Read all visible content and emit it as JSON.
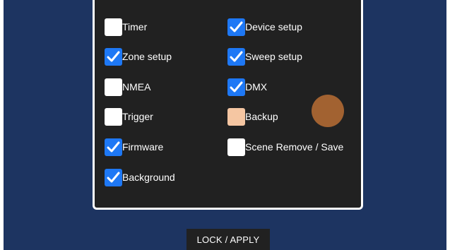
{
  "checkboxes": [
    {
      "label": "Timer",
      "checked": false
    },
    {
      "label": "Device setup",
      "checked": true
    },
    {
      "label": "Zone setup",
      "checked": true
    },
    {
      "label": "Sweep setup",
      "checked": true
    },
    {
      "label": "NMEA",
      "checked": false
    },
    {
      "label": "DMX",
      "checked": true
    },
    {
      "label": "Trigger",
      "checked": false
    },
    {
      "label": "Backup",
      "checked": false
    },
    {
      "label": "Firmware",
      "checked": true
    },
    {
      "label": "Scene Remove / Save",
      "checked": false
    },
    {
      "label": "Background",
      "checked": true
    }
  ],
  "lock_button": {
    "label": "LOCK / APPLY"
  },
  "colors": {
    "background": "#1d3461",
    "panel": "#212121",
    "checkbox_checked": "#1e78f5",
    "ripple": "#cd7837"
  }
}
